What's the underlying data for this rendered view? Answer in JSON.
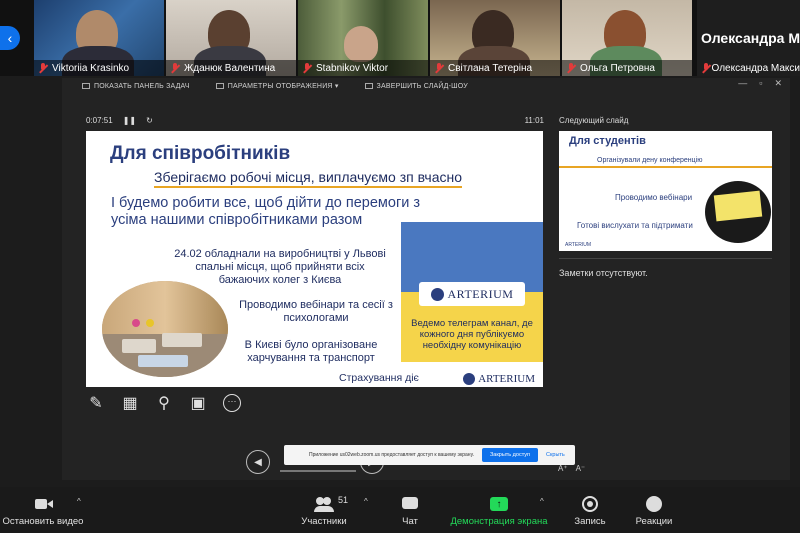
{
  "participants": [
    {
      "name": "Viktoriia Krasinko"
    },
    {
      "name": "Жданюк Валентина"
    },
    {
      "name": "Stabnikov Viktor"
    },
    {
      "name": "Світлана Тетеріна"
    },
    {
      "name": "Ольга Петровна"
    },
    {
      "name": "Олександра Макси"
    }
  ],
  "big_name": "Олександра М",
  "presenter_toolbar": {
    "show_taskbar": "ПОКАЗАТЬ ПАНЕЛЬ ЗАДАЧ",
    "display_settings": "ПАРАМЕТРЫ ОТОБРАЖЕНИЯ ▾",
    "end_show": "ЗАВЕРШИТЬ СЛАЙД-ШОУ"
  },
  "timer": {
    "elapsed": "0:07:51",
    "pause": "❚❚",
    "restart": "↻",
    "clock": "11:01"
  },
  "slide": {
    "title": "Для співробітників",
    "subtitle": "Зберігаємо робочі місця, виплачуємо зп вчасно",
    "para1": "І будемо робити все, щоб дійти до перемоги з усіма нашими співробітниками разом",
    "para2": "24.02 обладнали на виробництві у Львові спальні місця, щоб прийняти всіх бажаючих колег з Києва",
    "para3": "Проводимо вебінари та сесії з психологами",
    "para4": "В Києві було організоване харчування та транспорт",
    "para5": "Страхування діє",
    "logo": "ARTERIUM",
    "flag_text": "Ведемо телеграм канал, де кожного дня публікуємо необхідну комунікацію"
  },
  "next_slide": {
    "label": "Следующий слайд",
    "title": "Для студентів",
    "line1": "Організували дену конференцію",
    "line2": "Проводимо вебінари",
    "line3": "Готові вислухати та підтримати",
    "logo": "ARTERIUM"
  },
  "notes": "Заметки отсутствуют.",
  "font_ctrl": {
    "grow": "A⁺",
    "shrink": "A⁻"
  },
  "banner": {
    "text": "Приложение us02web.zoom.us предоставляет доступ к вашему экрану.",
    "button": "Закрыть доступ",
    "hide": "Скрыть"
  },
  "bottom_bar": {
    "video": "Остановить видео",
    "participants": "Участники",
    "participants_count": "51",
    "chat": "Чат",
    "share": "Демонстрация экрана",
    "record": "Запись",
    "reactions": "Реакции"
  },
  "colors": {
    "zoom_blue": "#0e71eb",
    "share_green": "#23d959",
    "mic_muted": "#e23b3b",
    "flag_blue": "#4a78c0",
    "flag_yellow": "#f5d44a"
  }
}
